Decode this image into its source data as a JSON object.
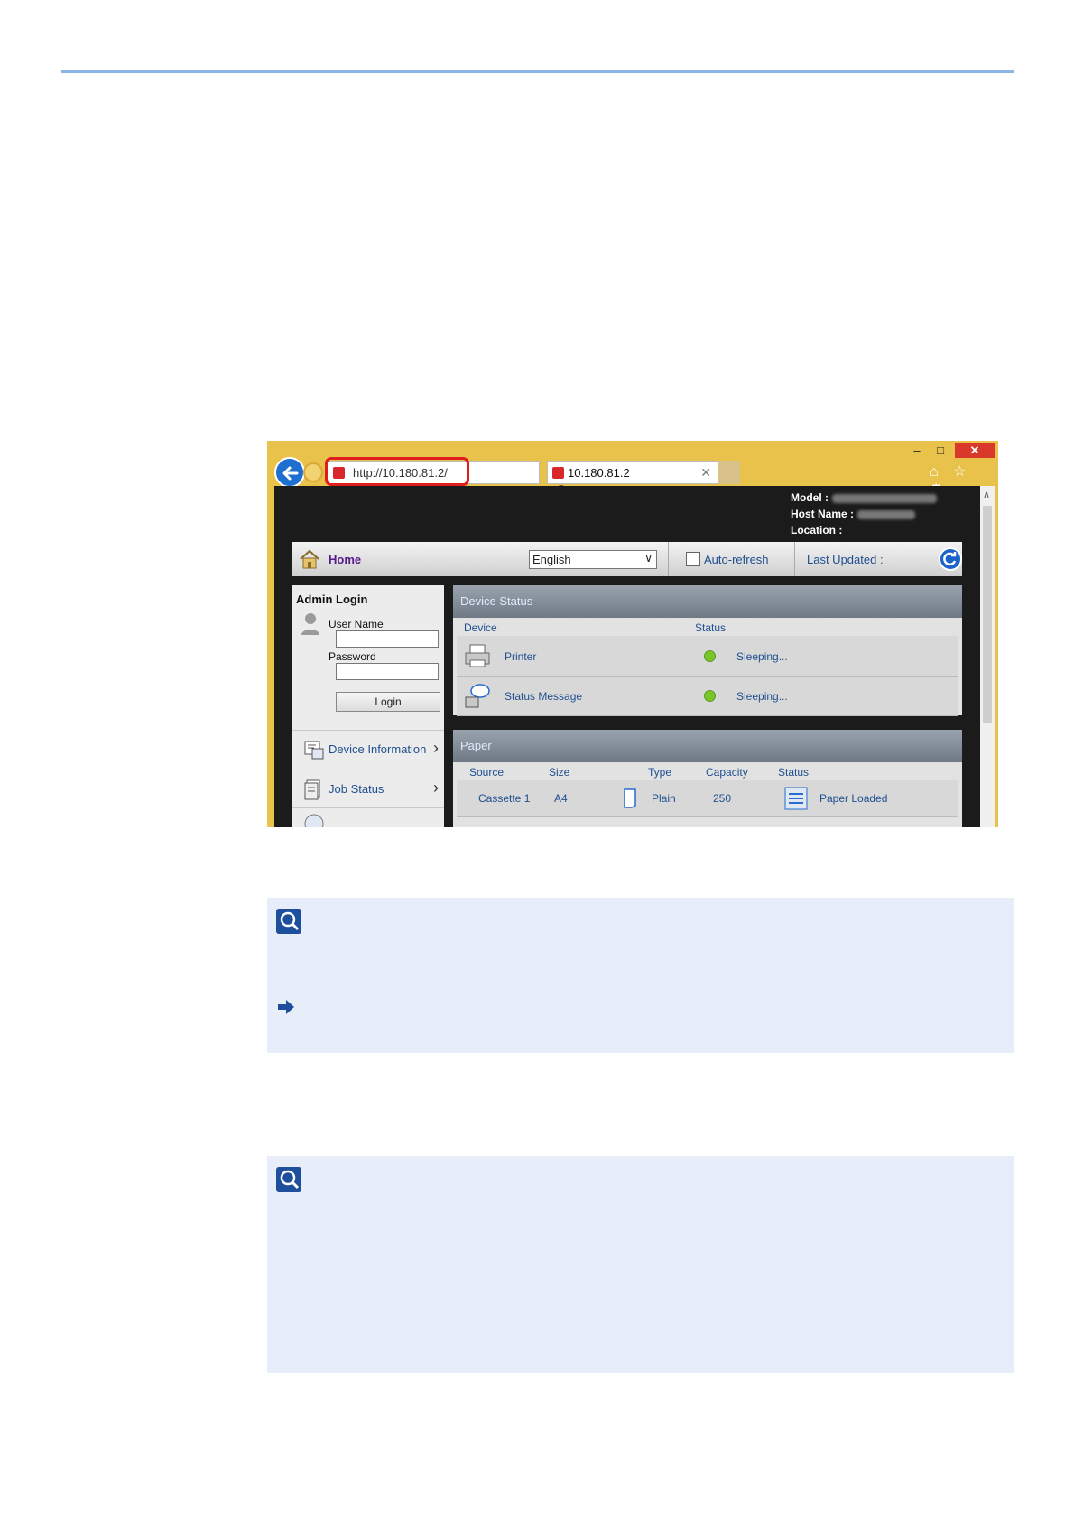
{
  "browser": {
    "window_controls": {
      "minimize": "–",
      "maximize": "□",
      "close": "✕"
    },
    "address": "http://10.180.81.2/",
    "tab_title": "10.180.81.2",
    "address_controls": "⌕ ▾ ↻",
    "tab_close": "✕",
    "toolbar_icons": [
      "home-icon",
      "star-icon",
      "gear-icon"
    ],
    "toolbar_glyphs": "⌂ ☆ ⚙"
  },
  "device_meta": {
    "model_label": "Model :",
    "host_label": "Host Name :",
    "location_label": "Location :"
  },
  "navbar": {
    "home_label": "Home",
    "language": "English",
    "auto_refresh_label": "Auto-refresh",
    "last_updated_label": "Last Updated :"
  },
  "admin_login": {
    "title": "Admin Login",
    "username_label": "User Name",
    "password_label": "Password",
    "login_button": "Login"
  },
  "side_menu": [
    {
      "label": "Device Information"
    },
    {
      "label": "Job Status"
    }
  ],
  "device_status": {
    "title": "Device Status",
    "headers": {
      "device": "Device",
      "status": "Status"
    },
    "rows": [
      {
        "device": "Printer",
        "status": "Sleeping..."
      },
      {
        "device": "Status Message",
        "status": "Sleeping..."
      }
    ]
  },
  "paper": {
    "title": "Paper",
    "headers": {
      "source": "Source",
      "size": "Size",
      "type": "Type",
      "capacity": "Capacity",
      "status": "Status"
    },
    "rows": [
      {
        "source": "Cassette 1",
        "size": "A4",
        "type": "Plain",
        "capacity": "250",
        "status": "Paper Loaded"
      }
    ]
  },
  "colors": {
    "rule": "#8fb3e6",
    "note_bg": "#e8eef9",
    "highlight": "#e01d1d",
    "browser_frame": "#e9c24c"
  }
}
